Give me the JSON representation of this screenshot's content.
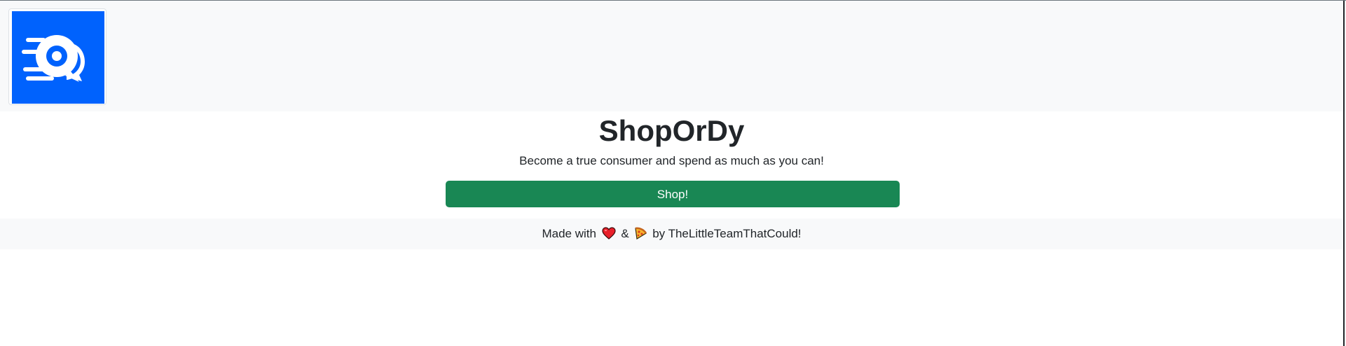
{
  "header": {
    "logo_icon": "chat-bubble-speed-icon",
    "brand_color": "#0062fd"
  },
  "hero": {
    "title": "ShopOrDy",
    "subtitle": "Become a true consumer and spend as much as you can!"
  },
  "actions": {
    "shop_label": "Shop!",
    "shop_color": "#198754"
  },
  "footer": {
    "made_with": "Made with",
    "amp": "&",
    "by": "by TheLittleTeamThatCould!",
    "heart_icon": "heart-icon",
    "pizza_icon": "pizza-icon"
  }
}
